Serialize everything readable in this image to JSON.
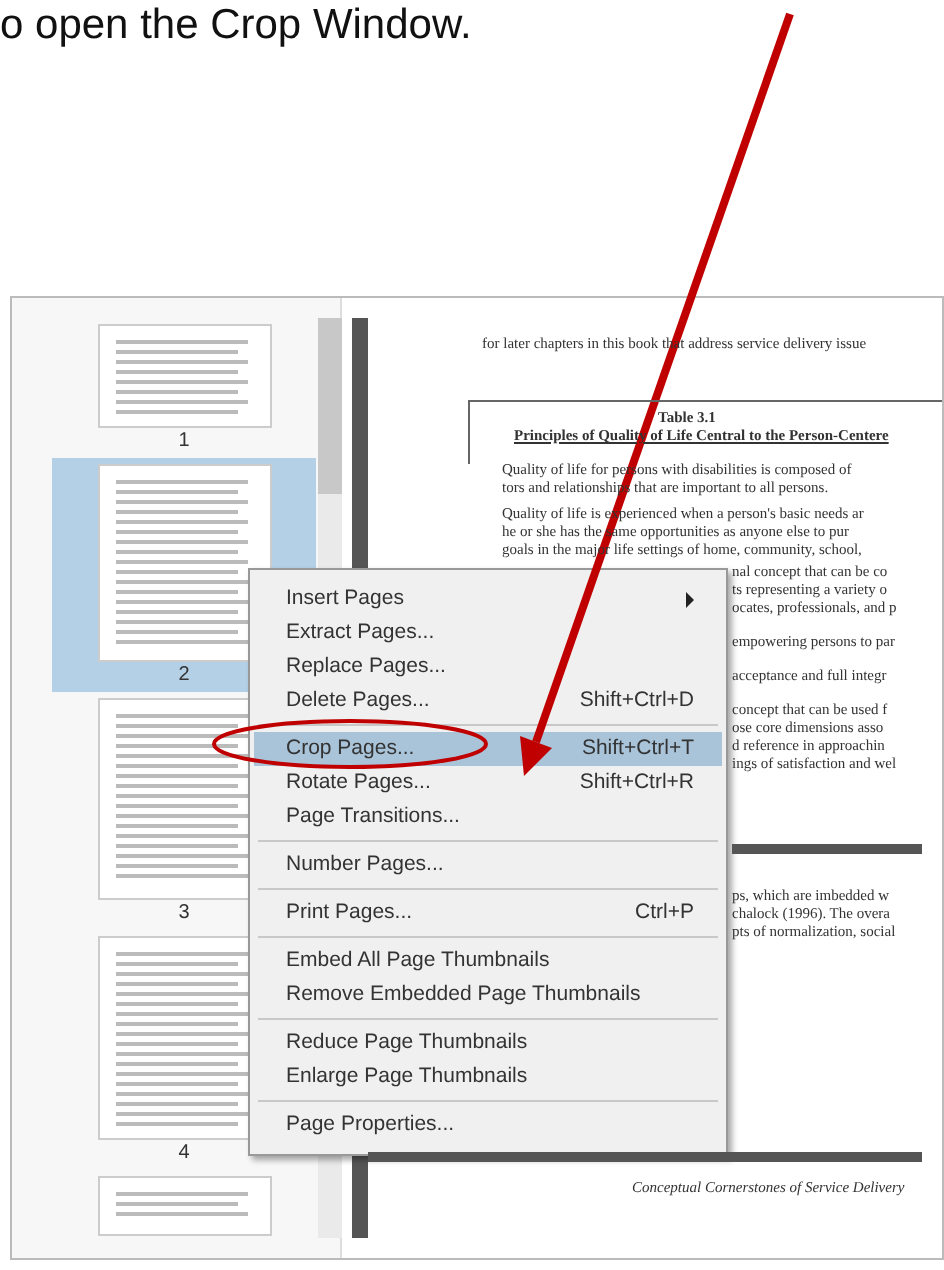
{
  "instruction_text": "o open the Crop Window.",
  "thumbnails": [
    {
      "label": "1",
      "selected": false
    },
    {
      "label": "2",
      "selected": true
    },
    {
      "label": "3",
      "selected": false
    },
    {
      "label": "4",
      "selected": false
    }
  ],
  "document": {
    "intro": "for later chapters in this book that address service delivery issue",
    "table_number": "Table 3.1",
    "table_title": "Principles of Quality of Life Central to the Person-Centere",
    "bullets": [
      {
        "lines": [
          "Quality of life for persons with disabilities is composed of",
          "tors and relationships that are important to all persons."
        ]
      },
      {
        "lines": [
          "Quality of life is experienced when a person's basic needs ar",
          "he or she has the same opportunities as anyone else to pur",
          "goals in the major life settings of home, community, school,"
        ]
      }
    ],
    "fragments": [
      "nal concept that can be co",
      "ts representing a variety o",
      "ocates, professionals, and p",
      "empowering persons to par",
      "acceptance and full integr",
      "concept that can be used f",
      "ose core dimensions asso",
      "d reference in approachin",
      "ings of satisfaction and wel"
    ],
    "fragments_after": [
      "ps, which are imbedded w",
      "chalock (1996). The overa",
      "pts of normalization, social"
    ],
    "footer": "Conceptual Cornerstones of Service Delivery"
  },
  "context_menu": {
    "groups": [
      [
        {
          "label": "Insert Pages",
          "submenu": true,
          "selected": false
        },
        {
          "label": "Extract Pages...",
          "submenu": false,
          "selected": false
        },
        {
          "label": "Replace Pages...",
          "submenu": false,
          "selected": false
        },
        {
          "label": "Delete Pages...",
          "shortcut": "Shift+Ctrl+D",
          "submenu": false,
          "selected": false
        }
      ],
      [
        {
          "label": "Crop Pages...",
          "shortcut": "Shift+Ctrl+T",
          "submenu": false,
          "selected": true
        },
        {
          "label": "Rotate Pages...",
          "shortcut": "Shift+Ctrl+R",
          "submenu": false,
          "selected": false
        },
        {
          "label": "Page Transitions...",
          "submenu": false,
          "selected": false
        }
      ],
      [
        {
          "label": "Number Pages...",
          "submenu": false,
          "selected": false
        }
      ],
      [
        {
          "label": "Print Pages...",
          "shortcut": "Ctrl+P",
          "submenu": false,
          "selected": false
        }
      ],
      [
        {
          "label": "Embed All Page Thumbnails",
          "submenu": false,
          "selected": false
        },
        {
          "label": "Remove Embedded Page Thumbnails",
          "submenu": false,
          "selected": false
        }
      ],
      [
        {
          "label": "Reduce Page Thumbnails",
          "submenu": false,
          "selected": false
        },
        {
          "label": "Enlarge Page Thumbnails",
          "submenu": false,
          "selected": false
        }
      ],
      [
        {
          "label": "Page Properties...",
          "submenu": false,
          "selected": false
        }
      ]
    ]
  }
}
